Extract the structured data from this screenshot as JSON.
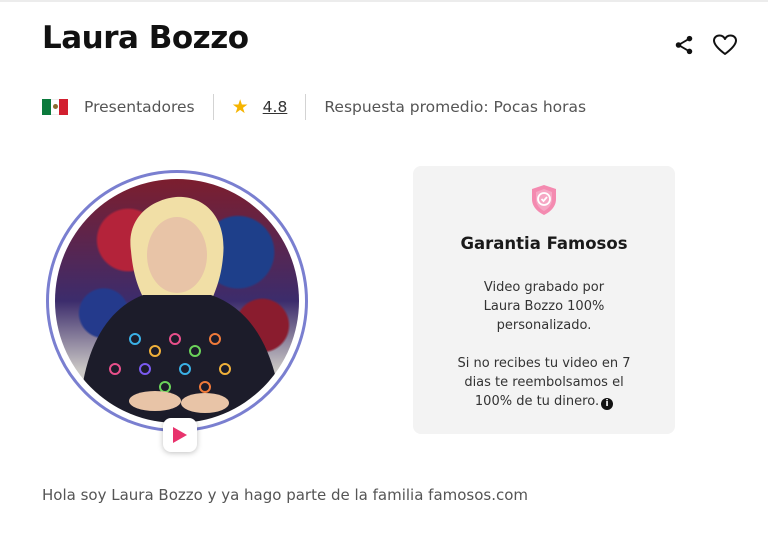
{
  "profile": {
    "name": "Laura Bozzo",
    "category": "Presentadores",
    "rating": "4.8",
    "response_time": "Respuesta promedio: Pocas horas",
    "country_flag": "Mexico"
  },
  "icons": {
    "share": "share-icon",
    "favorite": "heart-icon",
    "star": "star-icon",
    "play": "play-icon",
    "shield": "shield-icon",
    "info": "info-icon"
  },
  "guarantee": {
    "title": "Garantia Famosos",
    "line1": "Video grabado por Laura Bozzo 100% personalizado.",
    "line2": "Si no recibes tu video en 7 dias te reembolsamos el 100% de tu dinero."
  },
  "bio": "Hola soy Laura Bozzo y ya hago parte de la familia famosos.com",
  "colors": {
    "accent_pink": "#e8336d",
    "star": "#f5b400",
    "ring": "#7a7fd0",
    "card_bg": "#f3f3f3"
  }
}
